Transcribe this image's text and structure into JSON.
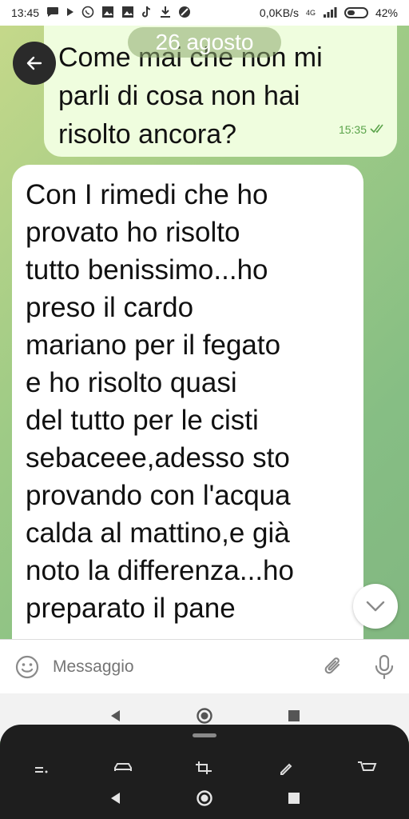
{
  "status_bar": {
    "time": "13:45",
    "network_speed": "0,0KB/s",
    "network_type": "4G",
    "battery_percent": "42%",
    "battery_level": 0.42,
    "notification_icons": [
      "chat-bubble-icon",
      "play-icon",
      "whatsapp-icon",
      "gallery-icon",
      "gallery-icon",
      "tiktok-icon",
      "download-icon",
      "blocked-icon"
    ]
  },
  "chat": {
    "date_label": "26 agosto",
    "outgoing": {
      "lines": [
        "Come mai che non mi",
        "parli di cosa non hai",
        "risolto ancora?"
      ],
      "time": "15:35",
      "status": "read"
    },
    "incoming": {
      "lines": [
        "Con I rimedi che ho",
        "provato ho risolto",
        "tutto benissimo...ho",
        "preso il cardo",
        "mariano per il fegato",
        "e ho risolto quasi",
        "del tutto per le cisti",
        "sebaceee,adesso sto",
        "provando con l'acqua",
        "calda al mattino,e già",
        "noto la differenza...ho",
        "preparato il pane"
      ]
    }
  },
  "input": {
    "placeholder": "Messaggio"
  },
  "colors": {
    "outgoing_bubble": "#effdde",
    "incoming_bubble": "#ffffff",
    "read_check": "#5aa34a",
    "toolbar": "#1e1e1e"
  }
}
